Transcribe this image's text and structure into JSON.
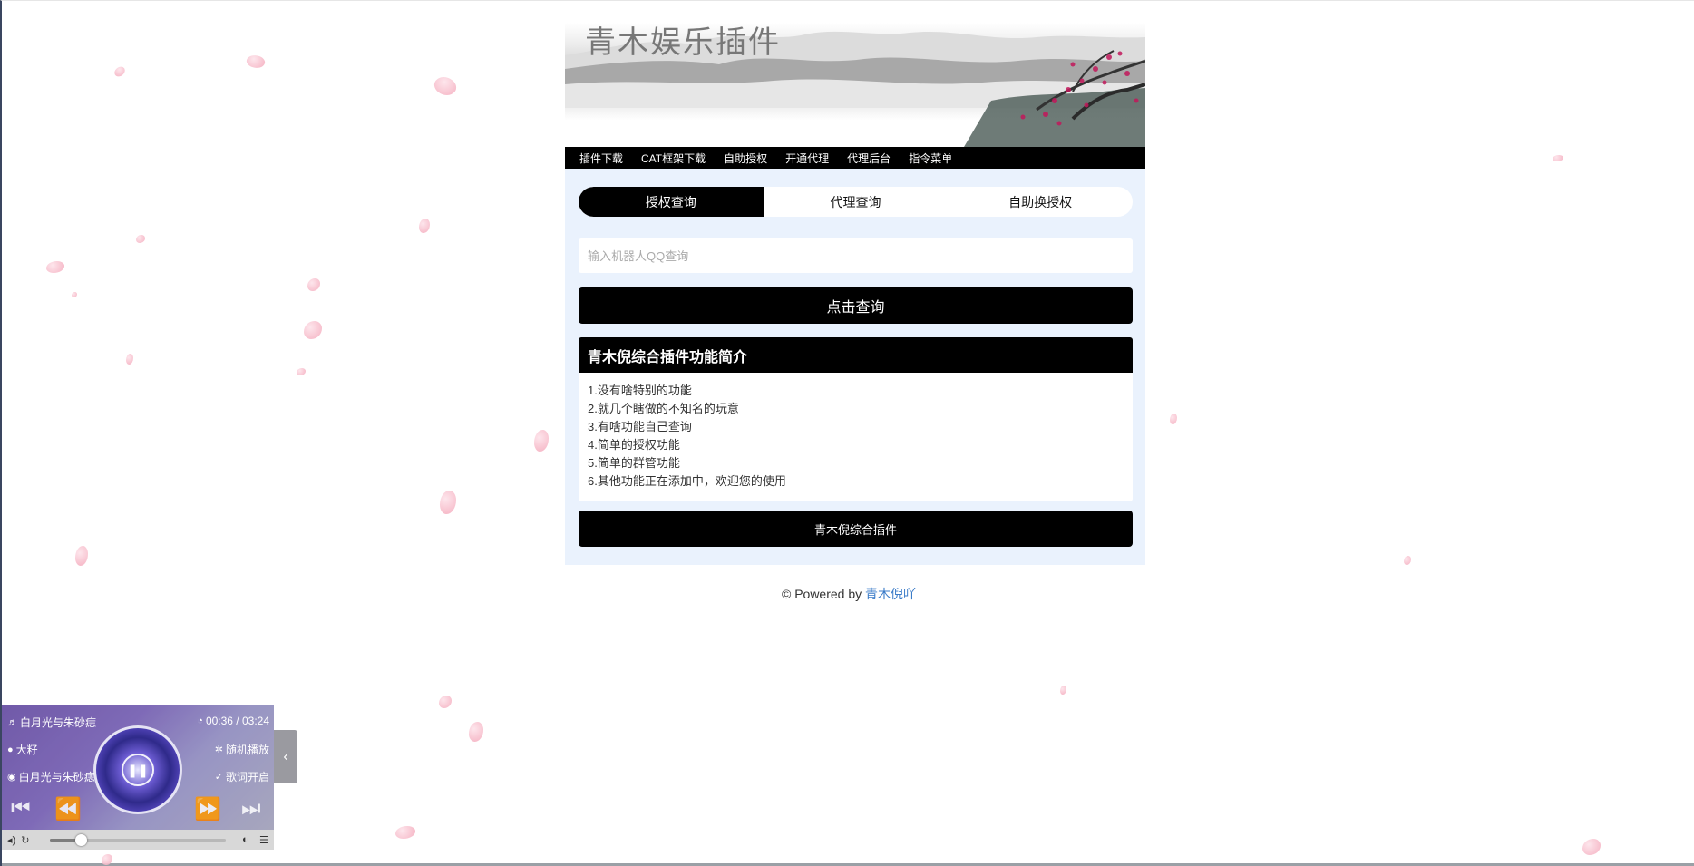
{
  "banner": {
    "title": "青木娱乐插件"
  },
  "nav": {
    "items": [
      "插件下载",
      "CAT框架下载",
      "自助授权",
      "开通代理",
      "代理后台",
      "指令菜单"
    ]
  },
  "tabs": [
    {
      "label": "授权查询",
      "active": true
    },
    {
      "label": "代理查询",
      "active": false
    },
    {
      "label": "自助换授权",
      "active": false
    }
  ],
  "search": {
    "placeholder": "输入机器人QQ查询",
    "value": ""
  },
  "query_button": "点击查询",
  "intro": {
    "title": "青木倪综合插件功能简介",
    "features": [
      "1.没有啥特别的功能",
      "2.就几个瞎做的不知名的玩意",
      "3.有啥功能自己查询",
      "4.简单的授权功能",
      "5.简单的群管功能",
      "6.其他功能正在添加中，欢迎您的使用"
    ]
  },
  "footer_button": "青木倪综合插件",
  "powered": {
    "prefix": "© Powered by ",
    "link": "青木倪吖"
  },
  "player": {
    "song": "白月光与朱砂痣",
    "artist": "大籽",
    "album": "白月光与朱砂痣",
    "time": "00:36 / 03:24",
    "mode": "随机播放",
    "lyrics": "歌词开启",
    "progress": 0.176
  },
  "colors": {
    "accent": "#000000",
    "panel_bg": "#eaf2fd",
    "link": "#3a7bc8",
    "petal": "#f4a9bb"
  }
}
